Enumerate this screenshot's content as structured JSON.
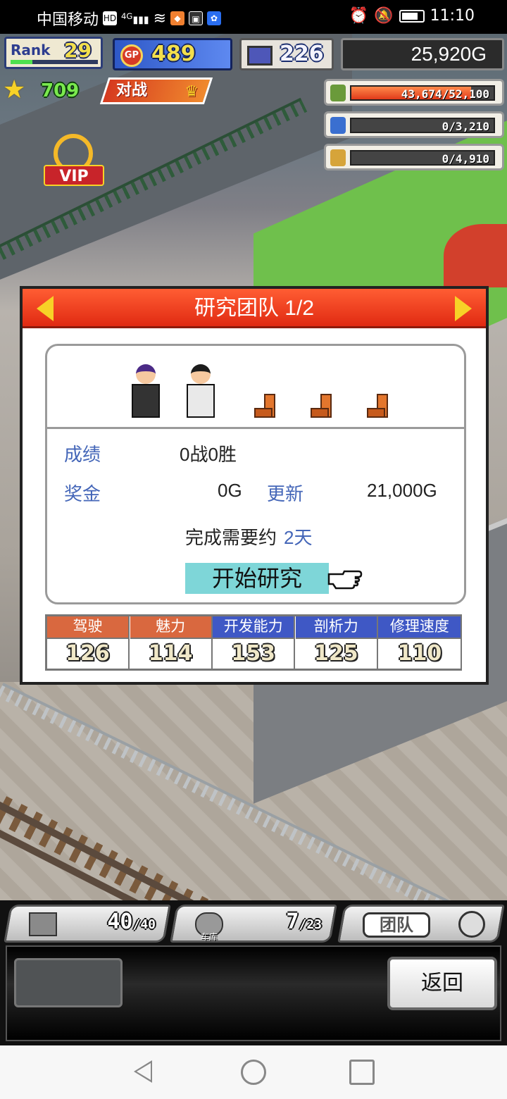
{
  "status_bar": {
    "carrier": "中国移动",
    "network": "4G",
    "time": "11:10"
  },
  "hud": {
    "rank_label": "Rank",
    "rank_value": "29",
    "rank_progress": 0.25,
    "gp_icon_text": "GP",
    "gp_value": "489",
    "pc_value": "226",
    "gold": "25,920G",
    "star_value": "709",
    "battle_label": "对战",
    "vip_label": "VIP"
  },
  "resources": [
    {
      "name": "money-bag-icon",
      "text": "43,674/52,100",
      "fill": 0.84,
      "color": "#6a9a3a"
    },
    {
      "name": "fuel-icon",
      "text": "0/3,210",
      "fill": 0.0,
      "color": "#3a6fd0"
    },
    {
      "name": "wheat-icon",
      "text": "0/4,910",
      "fill": 0.0,
      "color": "#d6a43a"
    }
  ],
  "modal": {
    "title": "研究团队 1/2",
    "record_label": "成绩",
    "record_value": "0战0胜",
    "prize_label": "奖金",
    "prize_value": "0G",
    "renew_label": "更新",
    "renew_value": "21,000G",
    "estimate_text": "完成需要约",
    "estimate_days": "2天",
    "start_button": "开始研究",
    "stats": [
      {
        "label": "驾驶",
        "value": "126"
      },
      {
        "label": "魅力",
        "value": "114"
      },
      {
        "label": "开发能力",
        "value": "153"
      },
      {
        "label": "剖析力",
        "value": "125"
      },
      {
        "label": "修理速度",
        "value": "110"
      }
    ]
  },
  "bottom": {
    "slot1_count": "40",
    "slot1_max": "/40",
    "garage_label": "车库",
    "slot2_count": "7",
    "slot2_max": "/23",
    "team_label": "团队",
    "back_button": "返回"
  }
}
